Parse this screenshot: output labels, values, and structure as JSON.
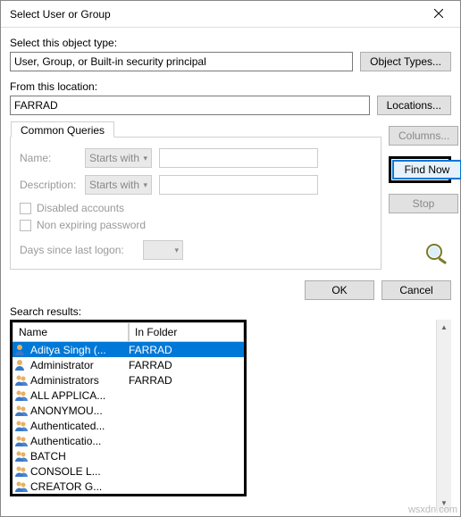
{
  "window": {
    "title": "Select User or Group"
  },
  "objectType": {
    "label": "Select this object type:",
    "value": "User, Group, or Built-in security principal",
    "button": "Object Types..."
  },
  "location": {
    "label": "From this location:",
    "value": "FARRAD",
    "button": "Locations..."
  },
  "queries": {
    "tab": "Common Queries",
    "name_label": "Name:",
    "desc_label": "Description:",
    "starts_with": "Starts with",
    "disabled_accounts": "Disabled accounts",
    "non_expiring": "Non expiring password",
    "days_label": "Days since last logon:"
  },
  "sideButtons": {
    "columns": "Columns...",
    "findNow": "Find Now",
    "stop": "Stop"
  },
  "dialogButtons": {
    "ok": "OK",
    "cancel": "Cancel"
  },
  "results": {
    "label": "Search results:",
    "col_name": "Name",
    "col_folder": "In Folder",
    "rows": [
      {
        "name": "Aditya Singh (...",
        "folder": "FARRAD",
        "type": "user",
        "selected": true
      },
      {
        "name": "Administrator",
        "folder": "FARRAD",
        "type": "user",
        "selected": false
      },
      {
        "name": "Administrators",
        "folder": "FARRAD",
        "type": "group",
        "selected": false
      },
      {
        "name": "ALL APPLICA...",
        "folder": "",
        "type": "group",
        "selected": false
      },
      {
        "name": "ANONYMOU...",
        "folder": "",
        "type": "group",
        "selected": false
      },
      {
        "name": "Authenticated...",
        "folder": "",
        "type": "group",
        "selected": false
      },
      {
        "name": "Authenticatio...",
        "folder": "",
        "type": "group",
        "selected": false
      },
      {
        "name": "BATCH",
        "folder": "",
        "type": "group",
        "selected": false
      },
      {
        "name": "CONSOLE L...",
        "folder": "",
        "type": "group",
        "selected": false
      },
      {
        "name": "CREATOR G...",
        "folder": "",
        "type": "group",
        "selected": false
      }
    ]
  },
  "watermark": "wsxdn.com"
}
